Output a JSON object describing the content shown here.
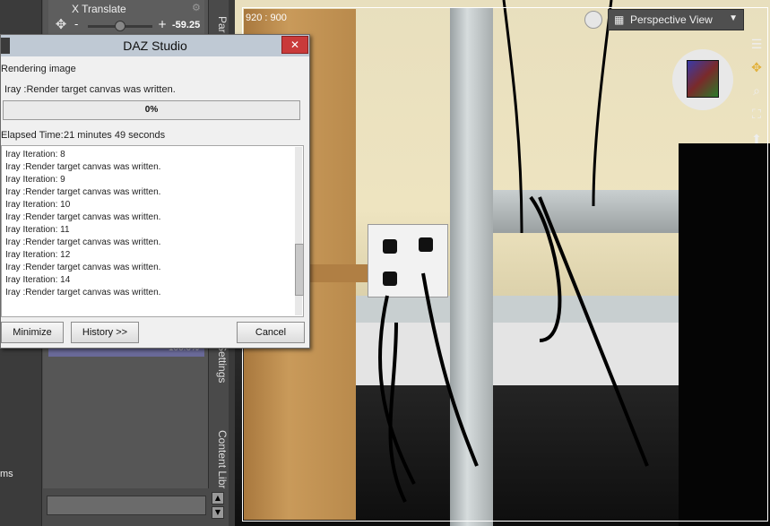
{
  "left_panel": {
    "bottom_label": "ms"
  },
  "params": {
    "title": "X Translate",
    "value": "-59.25",
    "minus": "-",
    "plus": "+",
    "percent": "100.0%"
  },
  "vertical_tabs": {
    "tab1": "Par",
    "tab2": "er Settings",
    "tab3": "Content Libr"
  },
  "viewport": {
    "resolution": "920 : 900",
    "view_label": "Perspective View"
  },
  "dialog": {
    "title": "DAZ Studio",
    "close": "✕",
    "status": "Rendering image",
    "message": "Iray :Render target canvas was written.",
    "progress_text": "0%",
    "progress_fraction": 0,
    "elapsed_label": "Elapsed Time:",
    "elapsed_value": "21 minutes 49 seconds",
    "log": [
      "Iray Iteration: 8",
      "Iray :Render target canvas was written.",
      "Iray Iteration: 9",
      "Iray :Render target canvas was written.",
      "Iray Iteration: 10",
      "Iray :Render target canvas was written.",
      "Iray Iteration: 11",
      "Iray :Render target canvas was written.",
      "Iray Iteration: 12",
      "Iray :Render target canvas was written.",
      "Iray Iteration: 14",
      "Iray :Render target canvas was written."
    ],
    "buttons": {
      "minimize": "Minimize",
      "history": "History >>",
      "cancel": "Cancel"
    }
  },
  "colors": {
    "close_red": "#c93a3a",
    "dialog_bg": "#f0f0f0",
    "title_bar": "#bfc9d4"
  }
}
